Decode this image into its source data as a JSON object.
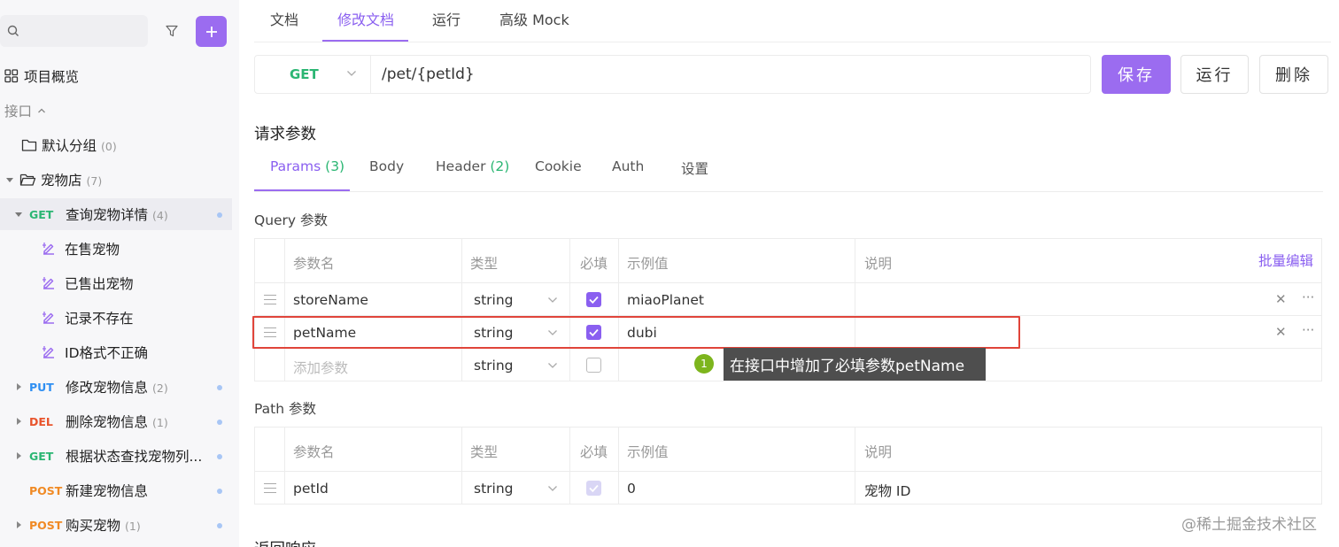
{
  "sidebar": {
    "overview_label": "项目概览",
    "interfaces_label": "接口",
    "items": [
      {
        "label": "默认分组",
        "count": "(0)"
      },
      {
        "label": "宠物店",
        "count": "(7)"
      },
      {
        "method": "GET",
        "label": "查询宠物详情",
        "count": "(4)"
      },
      {
        "label": "在售宠物"
      },
      {
        "label": "已售出宠物"
      },
      {
        "label": "记录不存在"
      },
      {
        "label": "ID格式不正确"
      },
      {
        "method": "PUT",
        "label": "修改宠物信息",
        "count": "(2)"
      },
      {
        "method": "DEL",
        "label": "删除宠物信息",
        "count": "(1)"
      },
      {
        "method": "GET",
        "label": "根据状态查找宠物列..."
      },
      {
        "method": "POST",
        "label": "新建宠物信息"
      },
      {
        "method": "POST",
        "label": "购买宠物",
        "count": "(1)"
      }
    ]
  },
  "top_tabs": [
    "文档",
    "修改文档",
    "运行",
    "高级 Mock"
  ],
  "request": {
    "method": "GET",
    "url": "/pet/{petId}",
    "save_label": "保存",
    "run_label": "运行",
    "delete_label": "删除"
  },
  "params_section": {
    "title": "请求参数",
    "tabs": [
      {
        "label": "Params",
        "badge": "(3)"
      },
      {
        "label": "Body"
      },
      {
        "label": "Header",
        "badge": "(2)"
      },
      {
        "label": "Cookie"
      },
      {
        "label": "Auth"
      },
      {
        "label": "设置"
      }
    ]
  },
  "query": {
    "title": "Query 参数",
    "bulk_edit": "批量编辑",
    "headers": [
      "参数名",
      "类型",
      "必填",
      "示例值",
      "说明"
    ],
    "rows": [
      {
        "name": "storeName",
        "type": "string",
        "required": true,
        "example": "miaoPlanet",
        "desc": ""
      },
      {
        "name": "petName",
        "type": "string",
        "required": true,
        "example": "dubi",
        "desc": ""
      }
    ],
    "add_placeholder": "添加参数",
    "add_type": "string"
  },
  "path": {
    "title": "Path 参数",
    "headers": [
      "参数名",
      "类型",
      "必填",
      "示例值",
      "说明"
    ],
    "rows": [
      {
        "name": "petId",
        "type": "string",
        "required": true,
        "example": "0",
        "desc": "宠物 ID"
      }
    ]
  },
  "annotation": {
    "number": "1",
    "text": "在接口中增加了必填参数petName"
  },
  "response_title": "返回响应",
  "watermark": "@稀土掘金技术社区",
  "colors": {
    "accent": "#9b6cf0",
    "get": "#2bb673",
    "put": "#2f8ff2",
    "del": "#e8542c",
    "post": "#f08a24",
    "highlight": "#e0443a"
  }
}
